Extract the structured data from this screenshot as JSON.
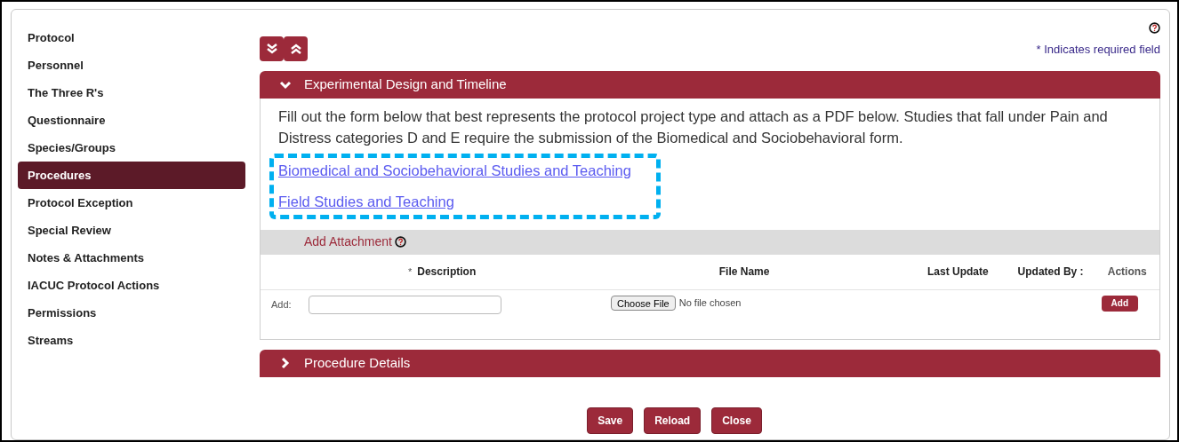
{
  "sidebar": {
    "items": [
      {
        "label": "Protocol",
        "selected": false
      },
      {
        "label": "Personnel",
        "selected": false
      },
      {
        "label": "The Three R's",
        "selected": false
      },
      {
        "label": "Questionnaire",
        "selected": false
      },
      {
        "label": "Species/Groups",
        "selected": false
      },
      {
        "label": "Procedures",
        "selected": true
      },
      {
        "label": "Protocol Exception",
        "selected": false
      },
      {
        "label": "Special Review",
        "selected": false
      },
      {
        "label": "Notes & Attachments",
        "selected": false
      },
      {
        "label": "IACUC Protocol Actions",
        "selected": false
      },
      {
        "label": "Permissions",
        "selected": false
      },
      {
        "label": "Streams",
        "selected": false
      }
    ]
  },
  "required_note": "* Indicates required field",
  "sections": [
    {
      "title": "Experimental Design and Timeline",
      "expanded": true,
      "instructions": "Fill out the form below that best represents the protocol project type and attach as a PDF below. Studies that fall under Pain and Distress categories D and E require the submission of the Biomedical and Sociobehavioral form.",
      "links": [
        "Biomedical and Sociobehavioral Studies and Teaching",
        "Field Studies and Teaching"
      ],
      "attachment": {
        "title": "Add Attachment",
        "columns": [
          {
            "marker": "*",
            "label": "Description"
          },
          {
            "label": "File Name"
          },
          {
            "label": "Last Update"
          },
          {
            "label": "Updated By :"
          },
          {
            "label": "Actions"
          }
        ],
        "row_label": "Add:",
        "file_button": "Choose File",
        "file_status": "No file chosen",
        "add_button": "Add"
      }
    },
    {
      "title": "Procedure Details",
      "expanded": false
    }
  ],
  "buttons": [
    "Save",
    "Reload",
    "Close"
  ]
}
